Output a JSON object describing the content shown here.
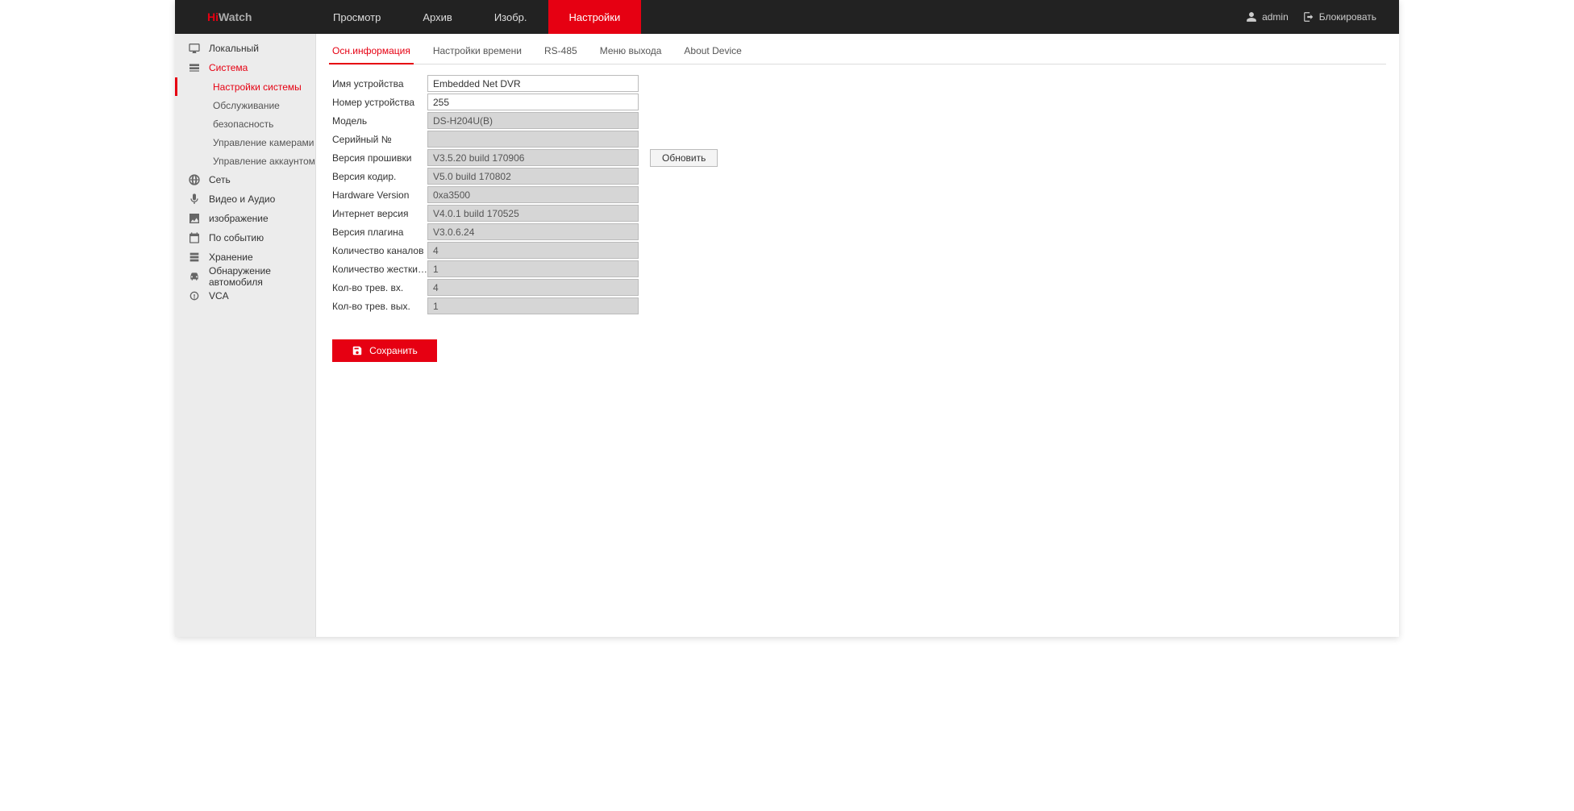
{
  "brand": {
    "part1": "Hi",
    "part2": "Watch"
  },
  "topnav": {
    "preview": "Просмотр",
    "archive": "Архив",
    "image": "Изобр.",
    "settings": "Настройки"
  },
  "topright": {
    "username": "admin",
    "logout": "Блокировать"
  },
  "sidebar": {
    "local": "Локальный",
    "system": "Система",
    "system_sub": {
      "system_settings": "Настройки системы",
      "maintenance": "Обслуживание",
      "security": "безопасность",
      "camera_mgmt": "Управление камерами",
      "account_mgmt": "Управление аккаунтом"
    },
    "network": "Сеть",
    "video_audio": "Видео и Аудио",
    "image": "изображение",
    "event": "По событию",
    "storage": "Хранение",
    "vehicle": "Обнаружение автомобиля",
    "vca": "VCA"
  },
  "subtabs": {
    "basic_info": "Осн.информация",
    "time_settings": "Настройки времени",
    "rs485": "RS-485",
    "output_menu": "Меню выхода",
    "about": "About Device"
  },
  "form": {
    "labels": {
      "device_name": "Имя устройства",
      "device_no": "Номер устройства",
      "model": "Модель",
      "serial": "Серийный №",
      "firmware": "Версия прошивки",
      "encoder": "Версия кодир.",
      "hardware": "Hardware Version",
      "web": "Интернет версия",
      "plugin": "Версия плагина",
      "channels": "Количество каналов",
      "hdds": "Количество жестких дис...",
      "alarm_in": "Кол-во трев. вх.",
      "alarm_out": "Кол-во трев. вых."
    },
    "values": {
      "device_name": "Embedded Net DVR",
      "device_no": "255",
      "model": "DS-H204U(B)",
      "serial": "",
      "firmware": "V3.5.20 build 170906",
      "encoder": "V5.0 build 170802",
      "hardware": "0xa3500",
      "web": "V4.0.1 build 170525",
      "plugin": "V3.0.6.24",
      "channels": "4",
      "hdds": "1",
      "alarm_in": "4",
      "alarm_out": "1"
    },
    "update_btn": "Обновить",
    "save_btn": "Сохранить"
  },
  "colors": {
    "accent": "#e60012",
    "topbar": "#222222",
    "sidebar": "#ececec"
  }
}
